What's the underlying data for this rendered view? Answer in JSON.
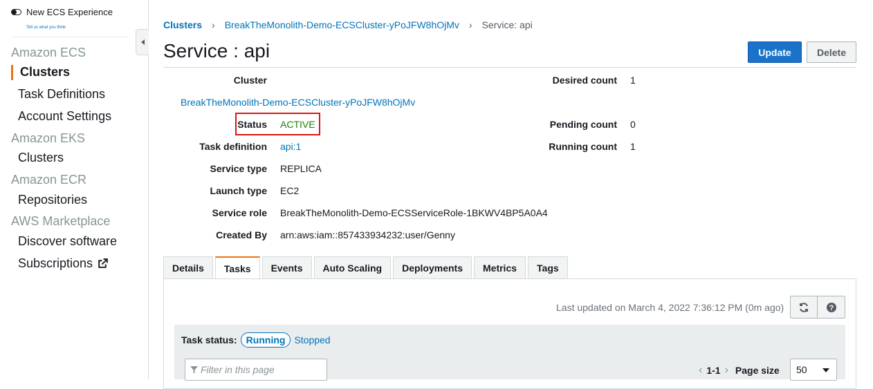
{
  "sidebar": {
    "toggle_label": "New ECS Experience",
    "tell_us": "Tell us what you think",
    "sections": [
      {
        "heading": "Amazon ECS",
        "items": [
          "Clusters",
          "Task Definitions",
          "Account Settings"
        ]
      },
      {
        "heading": "Amazon EKS",
        "items": [
          "Clusters"
        ]
      },
      {
        "heading": "Amazon ECR",
        "items": [
          "Repositories"
        ]
      },
      {
        "heading": "AWS Marketplace",
        "items": [
          "Discover software",
          "Subscriptions"
        ]
      }
    ],
    "active_item": "Clusters"
  },
  "breadcrumb": {
    "root": "Clusters",
    "cluster": "BreakTheMonolith-Demo-ECSCluster-yPoJFW8hOjMv",
    "current": "Service: api"
  },
  "page": {
    "title": "Service : api",
    "update_label": "Update",
    "delete_label": "Delete"
  },
  "details": {
    "cluster_label": "Cluster",
    "cluster_value": "BreakTheMonolith-Demo-ECSCluster-yPoJFW8hOjMv",
    "status_label": "Status",
    "status_value": "ACTIVE",
    "task_definition_label": "Task definition",
    "task_definition_value": "api:1",
    "service_type_label": "Service type",
    "service_type_value": "REPLICA",
    "launch_type_label": "Launch type",
    "launch_type_value": "EC2",
    "service_role_label": "Service role",
    "service_role_value": "BreakTheMonolith-Demo-ECSServiceRole-1BKWV4BP5A0A4",
    "created_by_label": "Created By",
    "created_by_value": "arn:aws:iam::857433934232:user/Genny",
    "desired_count_label": "Desired count",
    "desired_count_value": "1",
    "pending_count_label": "Pending count",
    "pending_count_value": "0",
    "running_count_label": "Running count",
    "running_count_value": "1"
  },
  "tabs": [
    "Details",
    "Tasks",
    "Events",
    "Auto Scaling",
    "Deployments",
    "Metrics",
    "Tags"
  ],
  "selected_tab": "Tasks",
  "tasks_panel": {
    "last_updated": "Last updated on March 4, 2022 7:36:12 PM (0m ago)",
    "task_status_label": "Task status:",
    "running_label": "Running",
    "stopped_label": "Stopped",
    "filter_placeholder": "Filter in this page",
    "page_range": "1-1",
    "page_size_label": "Page size",
    "page_size_value": "50"
  },
  "colors": {
    "accent": "#ec7211",
    "link": "#0073bb",
    "primary_button": "#1a73c8",
    "status_active": "#1d8102",
    "highlight_box": "#d91515"
  }
}
